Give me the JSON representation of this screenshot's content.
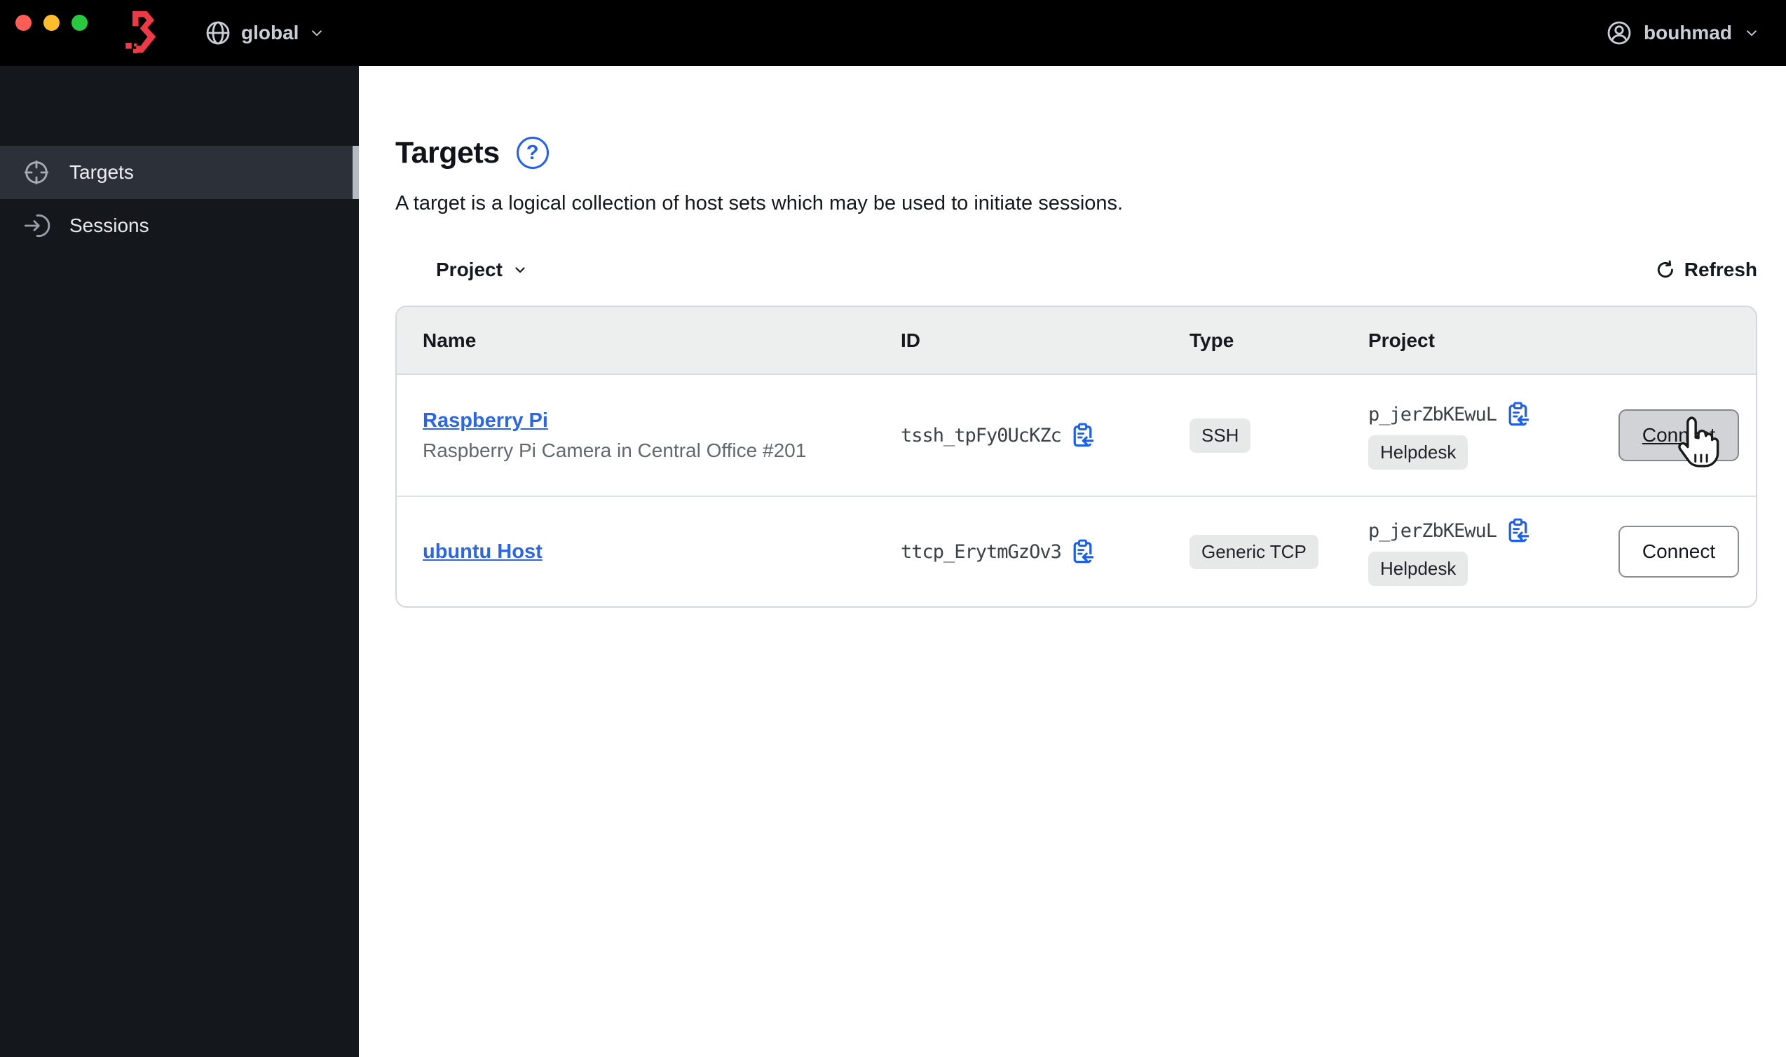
{
  "topbar": {
    "scope": {
      "label": "global",
      "icon": "globe-icon"
    },
    "user": {
      "name": "bouhmad",
      "icon": "user-circle-icon"
    }
  },
  "sidebar": {
    "items": [
      {
        "label": "Targets",
        "icon": "target-icon",
        "active": true
      },
      {
        "label": "Sessions",
        "icon": "sessions-icon",
        "active": false
      }
    ]
  },
  "main": {
    "title": "Targets",
    "help_glyph": "?",
    "description": "A target is a logical collection of host sets which may be used to initiate sessions.",
    "toolbar": {
      "filter_label": "Project",
      "refresh_label": "Refresh",
      "refresh_icon": "refresh-icon"
    },
    "table": {
      "columns": [
        "Name",
        "ID",
        "Type",
        "Project"
      ],
      "rows": [
        {
          "name": "Raspberry Pi",
          "description": "Raspberry Pi Camera in Central Office #201",
          "id": "tssh_tpFy0UcKZc",
          "type": "SSH",
          "project_id": "p_jerZbKEwuL",
          "project_name": "Helpdesk",
          "action": "Connect",
          "state": "hovered"
        },
        {
          "name": "ubuntu Host",
          "description": "",
          "id": "ttcp_ErytmGzOv3",
          "type": "Generic TCP",
          "project_id": "p_jerZbKEwuL",
          "project_name": "Helpdesk",
          "action": "Connect",
          "state": "normal"
        }
      ]
    }
  },
  "colors": {
    "topbar_bg": "#000000",
    "sidebar_bg": "#14171b",
    "sidebar_active_bg": "#2c3038",
    "logo_red": "#ec3b47",
    "light_red": "#ff5d55",
    "light_yellow": "#ffbd2e",
    "light_green": "#28c83f",
    "link_blue": "#2d66e2",
    "icon_blue": "#1c5feb",
    "help_blue": "#2160f0",
    "badge_bg": "#e7e9e9",
    "table_header_bg": "#edefee"
  }
}
